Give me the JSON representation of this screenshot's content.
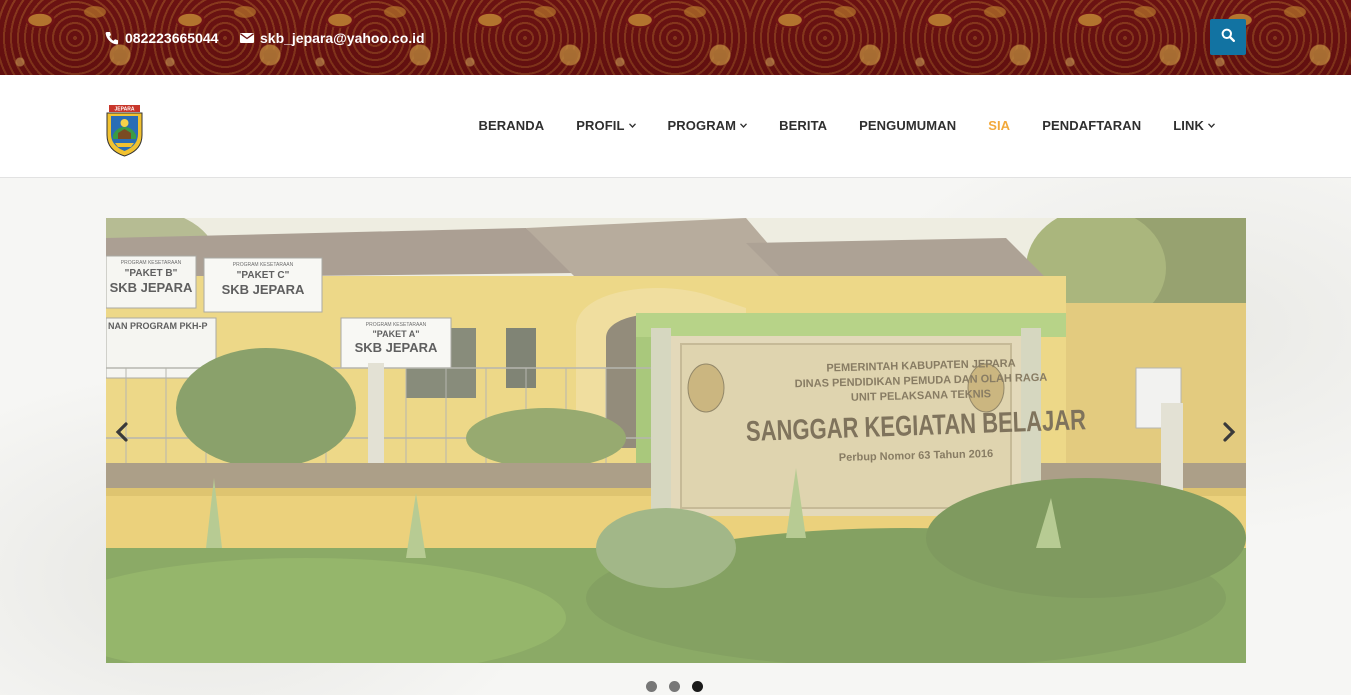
{
  "topbar": {
    "phone": "082223665044",
    "email": "skb_jepara@yahoo.co.id",
    "phone_icon": "phone-icon",
    "email_icon": "envelope-icon",
    "search_icon": "search-icon"
  },
  "nav": {
    "logo_alt": "JEPARA",
    "items": [
      {
        "label": "BERANDA",
        "has_dropdown": false,
        "active": false
      },
      {
        "label": "PROFIL",
        "has_dropdown": true,
        "active": false
      },
      {
        "label": "PROGRAM",
        "has_dropdown": true,
        "active": false
      },
      {
        "label": "BERITA",
        "has_dropdown": false,
        "active": false
      },
      {
        "label": "PENGUMUMAN",
        "has_dropdown": false,
        "active": false
      },
      {
        "label": "SIA",
        "has_dropdown": false,
        "active": true
      },
      {
        "label": "PENDAFTARAN",
        "has_dropdown": false,
        "active": false
      },
      {
        "label": "LINK",
        "has_dropdown": true,
        "active": false
      }
    ]
  },
  "slider": {
    "sign": {
      "line1": "PEMERINTAH KABUPATEN JEPARA",
      "line2": "DINAS PENDIDIKAN PEMUDA DAN OLAH RAGA",
      "line3": "UNIT PELAKSANA TEKNIS",
      "title": "SANGGAR KEGIATAN BELAJAR",
      "perbup": "Perbup Nomor 63 Tahun 2016"
    },
    "boards": {
      "b1_top": "PROGRAM KESETARAAN",
      "b1_label": "\"PAKET B\"",
      "b1_name": "SKB JEPARA",
      "b2_top": "PROGRAM KESETARAAN",
      "b2_label": "\"PAKET C\"",
      "b2_name": "SKB JEPARA",
      "b3_top": "PROGRAM KESETARAAN",
      "b3_label": "\"PAKET A\"",
      "b3_name": "SKB JEPARA",
      "b4_title": "NAN PROGRAM PKH-P"
    },
    "total_slides": 3,
    "active_slide": 3
  },
  "colors": {
    "accent_active": "#f2a93b",
    "search_button": "#1273a2",
    "topbar_base": "#6e1414"
  }
}
